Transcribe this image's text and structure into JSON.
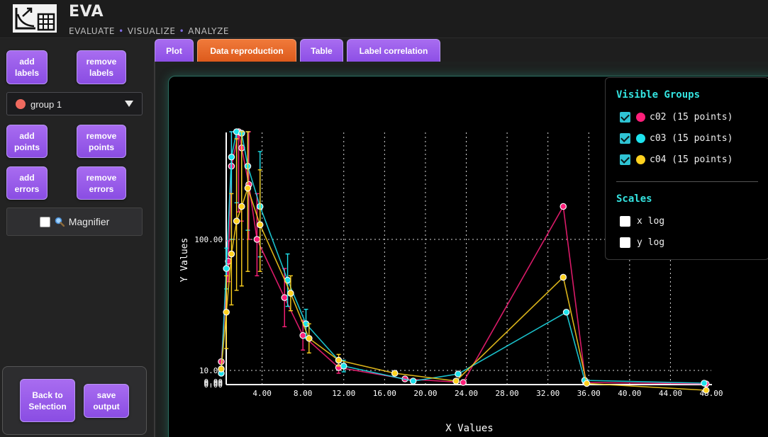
{
  "app": {
    "title": "EVA",
    "subtitle": [
      "EVALUATE",
      "VISUALIZE",
      "ANALYZE"
    ]
  },
  "sidebar": {
    "add_labels": "add labels",
    "remove_labels": "remove labels",
    "group_select": {
      "value": "group 1",
      "color": "#f06a5e"
    },
    "add_points": "add points",
    "remove_points": "remove points",
    "add_errors": "add errors",
    "remove_errors": "remove errors",
    "magnifier": {
      "label": "Magnifier",
      "checked": false
    },
    "back_to_selection": "Back to Selection",
    "save_output": "save output"
  },
  "tabs": [
    {
      "label": "Plot",
      "active": false
    },
    {
      "label": "Data reproduction",
      "active": true
    },
    {
      "label": "Table",
      "active": false
    },
    {
      "label": "Label correlation",
      "active": false
    }
  ],
  "legend": {
    "visible_groups_title": "Visible Groups",
    "groups": [
      {
        "label": "c02 (15 points)",
        "color": "#ff1f7a",
        "checked": true
      },
      {
        "label": "c03 (15 points)",
        "color": "#1ee3ee",
        "checked": true
      },
      {
        "label": "c04 (15 points)",
        "color": "#ffd21f",
        "checked": true
      }
    ],
    "scales_title": "Scales",
    "scales": [
      {
        "label": "x log",
        "checked": false
      },
      {
        "label": "y log",
        "checked": false
      }
    ]
  },
  "chart_data": {
    "type": "line",
    "xlabel": "X Values",
    "ylabel": "Y Values",
    "xlim": [
      0,
      48
    ],
    "ylim": [
      0,
      110
    ],
    "x_ticks": [
      "4.00",
      "8.00",
      "12.00",
      "16.00",
      "20.00",
      "24.00",
      "28.00",
      "32.00",
      "36.00",
      "40.00",
      "44.00",
      "48.00"
    ],
    "y_ticks": [
      "0.00",
      "0.00",
      "0.00",
      "10.00",
      "100.00"
    ],
    "grid": true,
    "series": [
      {
        "name": "c02",
        "color": "#ff1f7a",
        "points": [
          {
            "x": 0.0,
            "y": 16,
            "err": 0
          },
          {
            "x": 0.7,
            "y": 85,
            "err": 14
          },
          {
            "x": 1.0,
            "y": 140,
            "err": 40
          },
          {
            "x": 1.7,
            "y": 160,
            "err": 45
          },
          {
            "x": 2.0,
            "y": 150,
            "err": 40
          },
          {
            "x": 2.7,
            "y": 130,
            "err": 30
          },
          {
            "x": 3.5,
            "y": 100,
            "err": 25
          },
          {
            "x": 6.2,
            "y": 60,
            "err": 20
          },
          {
            "x": 8.0,
            "y": 34,
            "err": 10
          },
          {
            "x": 11.5,
            "y": 12,
            "err": 4
          },
          {
            "x": 18.0,
            "y": 4,
            "err": 0
          },
          {
            "x": 23.7,
            "y": 1.5,
            "err": 0
          },
          {
            "x": 33.5,
            "y": 118,
            "err": 0
          },
          {
            "x": 35.7,
            "y": 1.5,
            "err": 0
          },
          {
            "x": 47.5,
            "y": 0.5,
            "err": 0
          }
        ]
      },
      {
        "name": "c03",
        "color": "#1ee3ee",
        "points": [
          {
            "x": 0.0,
            "y": 8,
            "err": 0
          },
          {
            "x": 0.5,
            "y": 80,
            "err": 14
          },
          {
            "x": 1.0,
            "y": 145,
            "err": 45
          },
          {
            "x": 1.5,
            "y": 160,
            "err": 40
          },
          {
            "x": 2.0,
            "y": 158,
            "err": 40
          },
          {
            "x": 2.6,
            "y": 140,
            "err": 35
          },
          {
            "x": 3.8,
            "y": 118,
            "err": 30
          },
          {
            "x": 6.5,
            "y": 72,
            "err": 18
          },
          {
            "x": 8.3,
            "y": 42,
            "err": 10
          },
          {
            "x": 12.0,
            "y": 13,
            "err": 4
          },
          {
            "x": 18.8,
            "y": 2.5,
            "err": 0
          },
          {
            "x": 23.2,
            "y": 7.5,
            "err": 0
          },
          {
            "x": 33.8,
            "y": 50,
            "err": 0
          },
          {
            "x": 35.6,
            "y": 3,
            "err": 0
          },
          {
            "x": 47.3,
            "y": 1,
            "err": 0
          }
        ]
      },
      {
        "name": "c04",
        "color": "#ffd21f",
        "points": [
          {
            "x": 0.0,
            "y": 11,
            "err": 0
          },
          {
            "x": 0.5,
            "y": 50,
            "err": 25
          },
          {
            "x": 1.0,
            "y": 90,
            "err": 35
          },
          {
            "x": 1.5,
            "y": 110,
            "err": 45
          },
          {
            "x": 2.0,
            "y": 118,
            "err": 50
          },
          {
            "x": 2.6,
            "y": 128,
            "err": 50
          },
          {
            "x": 3.8,
            "y": 108,
            "err": 30
          },
          {
            "x": 6.8,
            "y": 63,
            "err": 12
          },
          {
            "x": 8.6,
            "y": 32,
            "err": 10
          },
          {
            "x": 11.5,
            "y": 17,
            "err": 4
          },
          {
            "x": 17.0,
            "y": 8,
            "err": 0
          },
          {
            "x": 23.0,
            "y": 2.5,
            "err": 0
          },
          {
            "x": 33.5,
            "y": 74,
            "err": 0
          },
          {
            "x": 35.8,
            "y": 0.8,
            "err": 0
          },
          {
            "x": 47.5,
            "y": -4,
            "err": 0
          }
        ]
      }
    ]
  }
}
